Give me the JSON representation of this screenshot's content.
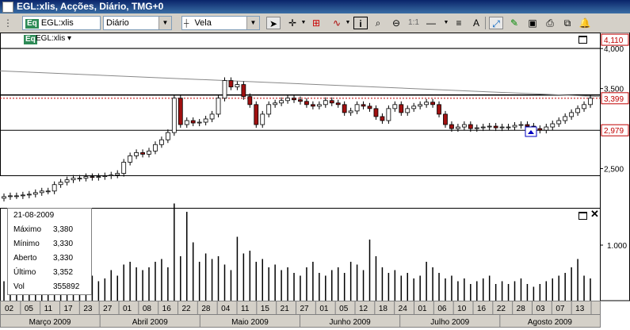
{
  "window": {
    "title": "EGL:xlis, Acções, Diário, TMG+0"
  },
  "toolbar": {
    "symbol_value": "EGL:xlis",
    "period_value": "Diário",
    "chart_type_value": "Vela",
    "ratio_label": "1:1"
  },
  "panel": {
    "symbol_label": "EGL:xlis"
  },
  "info": {
    "date": "21-08-2009",
    "rows": [
      {
        "label": "Máximo",
        "value": "3,380"
      },
      {
        "label": "Mínimo",
        "value": "3,330"
      },
      {
        "label": "Aberto",
        "value": "3,330"
      },
      {
        "label": "Último",
        "value": "3,352"
      },
      {
        "label": "Vol",
        "value": "355892"
      }
    ]
  },
  "colors": {
    "up": "#ffffff",
    "down": "#a01010",
    "ref_line": "#c00000",
    "accent": "#0000c0"
  },
  "chart_data": {
    "type": "candlestick",
    "price_axis": {
      "ticks": [
        "4,000",
        "3,500",
        "2,500"
      ],
      "markers": [
        "4,110",
        "3,399",
        "2,979"
      ],
      "range": [
        2.0,
        4.2
      ]
    },
    "volume_axis": {
      "ticks": [
        "1.000"
      ]
    },
    "x_labels": [
      "02",
      "05",
      "11",
      "17",
      "23",
      "27",
      "01",
      "08",
      "16",
      "22",
      "28",
      "04",
      "11",
      "15",
      "21",
      "27",
      "01",
      "05",
      "12",
      "18",
      "24",
      "01",
      "06",
      "10",
      "16",
      "22",
      "28",
      "03",
      "07",
      "13"
    ],
    "months": [
      "Março 2009",
      "Abril 2009",
      "Maio 2009",
      "Junho 2009",
      "Julho 2009",
      "Agosto 2009"
    ],
    "horizontal_lines": [
      4.0,
      3.399,
      3.4,
      2.979
    ],
    "trendline": {
      "from": 3.72,
      "to": 3.4
    },
    "series": [
      {
        "name": "price",
        "values": [
          2.15,
          2.16,
          2.16,
          2.17,
          2.18,
          2.2,
          2.22,
          2.22,
          2.3,
          2.33,
          2.36,
          2.38,
          2.38,
          2.4,
          2.39,
          2.4,
          2.41,
          2.42,
          2.44,
          2.58,
          2.66,
          2.7,
          2.68,
          2.72,
          2.8,
          2.86,
          2.95,
          3.38,
          3.05,
          3.1,
          3.07,
          3.08,
          3.12,
          3.18,
          3.38,
          3.6,
          3.52,
          3.55,
          3.4,
          3.3,
          3.05,
          3.18,
          3.3,
          3.32,
          3.35,
          3.38,
          3.36,
          3.34,
          3.3,
          3.28,
          3.3,
          3.35,
          3.32,
          3.3,
          3.2,
          3.22,
          3.3,
          3.28,
          3.25,
          3.15,
          3.1,
          3.25,
          3.3,
          3.2,
          3.25,
          3.28,
          3.3,
          3.33,
          3.3,
          3.18,
          3.05,
          3.0,
          3.02,
          3.05,
          3.0,
          3.01,
          3.02,
          3.03,
          3.01,
          3.02,
          3.02,
          3.04,
          3.05,
          3.03,
          3.0,
          2.98,
          3.02,
          3.06,
          3.1,
          3.15,
          3.2,
          3.25,
          3.3,
          3.38
        ]
      },
      {
        "name": "volume",
        "values": [
          0.35,
          0.3,
          0.4,
          0.35,
          0.3,
          0.4,
          0.35,
          0.38,
          0.45,
          0.6,
          0.5,
          0.45,
          0.4,
          0.5,
          0.45,
          0.35,
          0.4,
          0.55,
          0.45,
          0.65,
          0.7,
          0.6,
          0.55,
          0.6,
          0.7,
          0.75,
          0.6,
          1.75,
          0.8,
          1.6,
          1.05,
          0.7,
          0.85,
          0.75,
          0.8,
          0.65,
          0.55,
          1.15,
          0.85,
          0.9,
          0.7,
          0.75,
          0.6,
          0.65,
          0.55,
          0.6,
          0.5,
          0.45,
          0.6,
          0.7,
          0.5,
          0.45,
          0.55,
          0.6,
          0.5,
          0.7,
          0.65,
          0.55,
          1.1,
          0.8,
          0.6,
          0.5,
          0.55,
          0.45,
          0.5,
          0.4,
          0.45,
          0.7,
          0.6,
          0.5,
          0.4,
          0.45,
          0.35,
          0.4,
          0.3,
          0.35,
          0.4,
          0.45,
          0.3,
          0.35,
          0.3,
          0.35,
          0.4,
          0.3,
          0.25,
          0.3,
          0.35,
          0.4,
          0.45,
          0.5,
          0.6,
          0.75,
          0.45,
          0.4
        ]
      }
    ]
  }
}
